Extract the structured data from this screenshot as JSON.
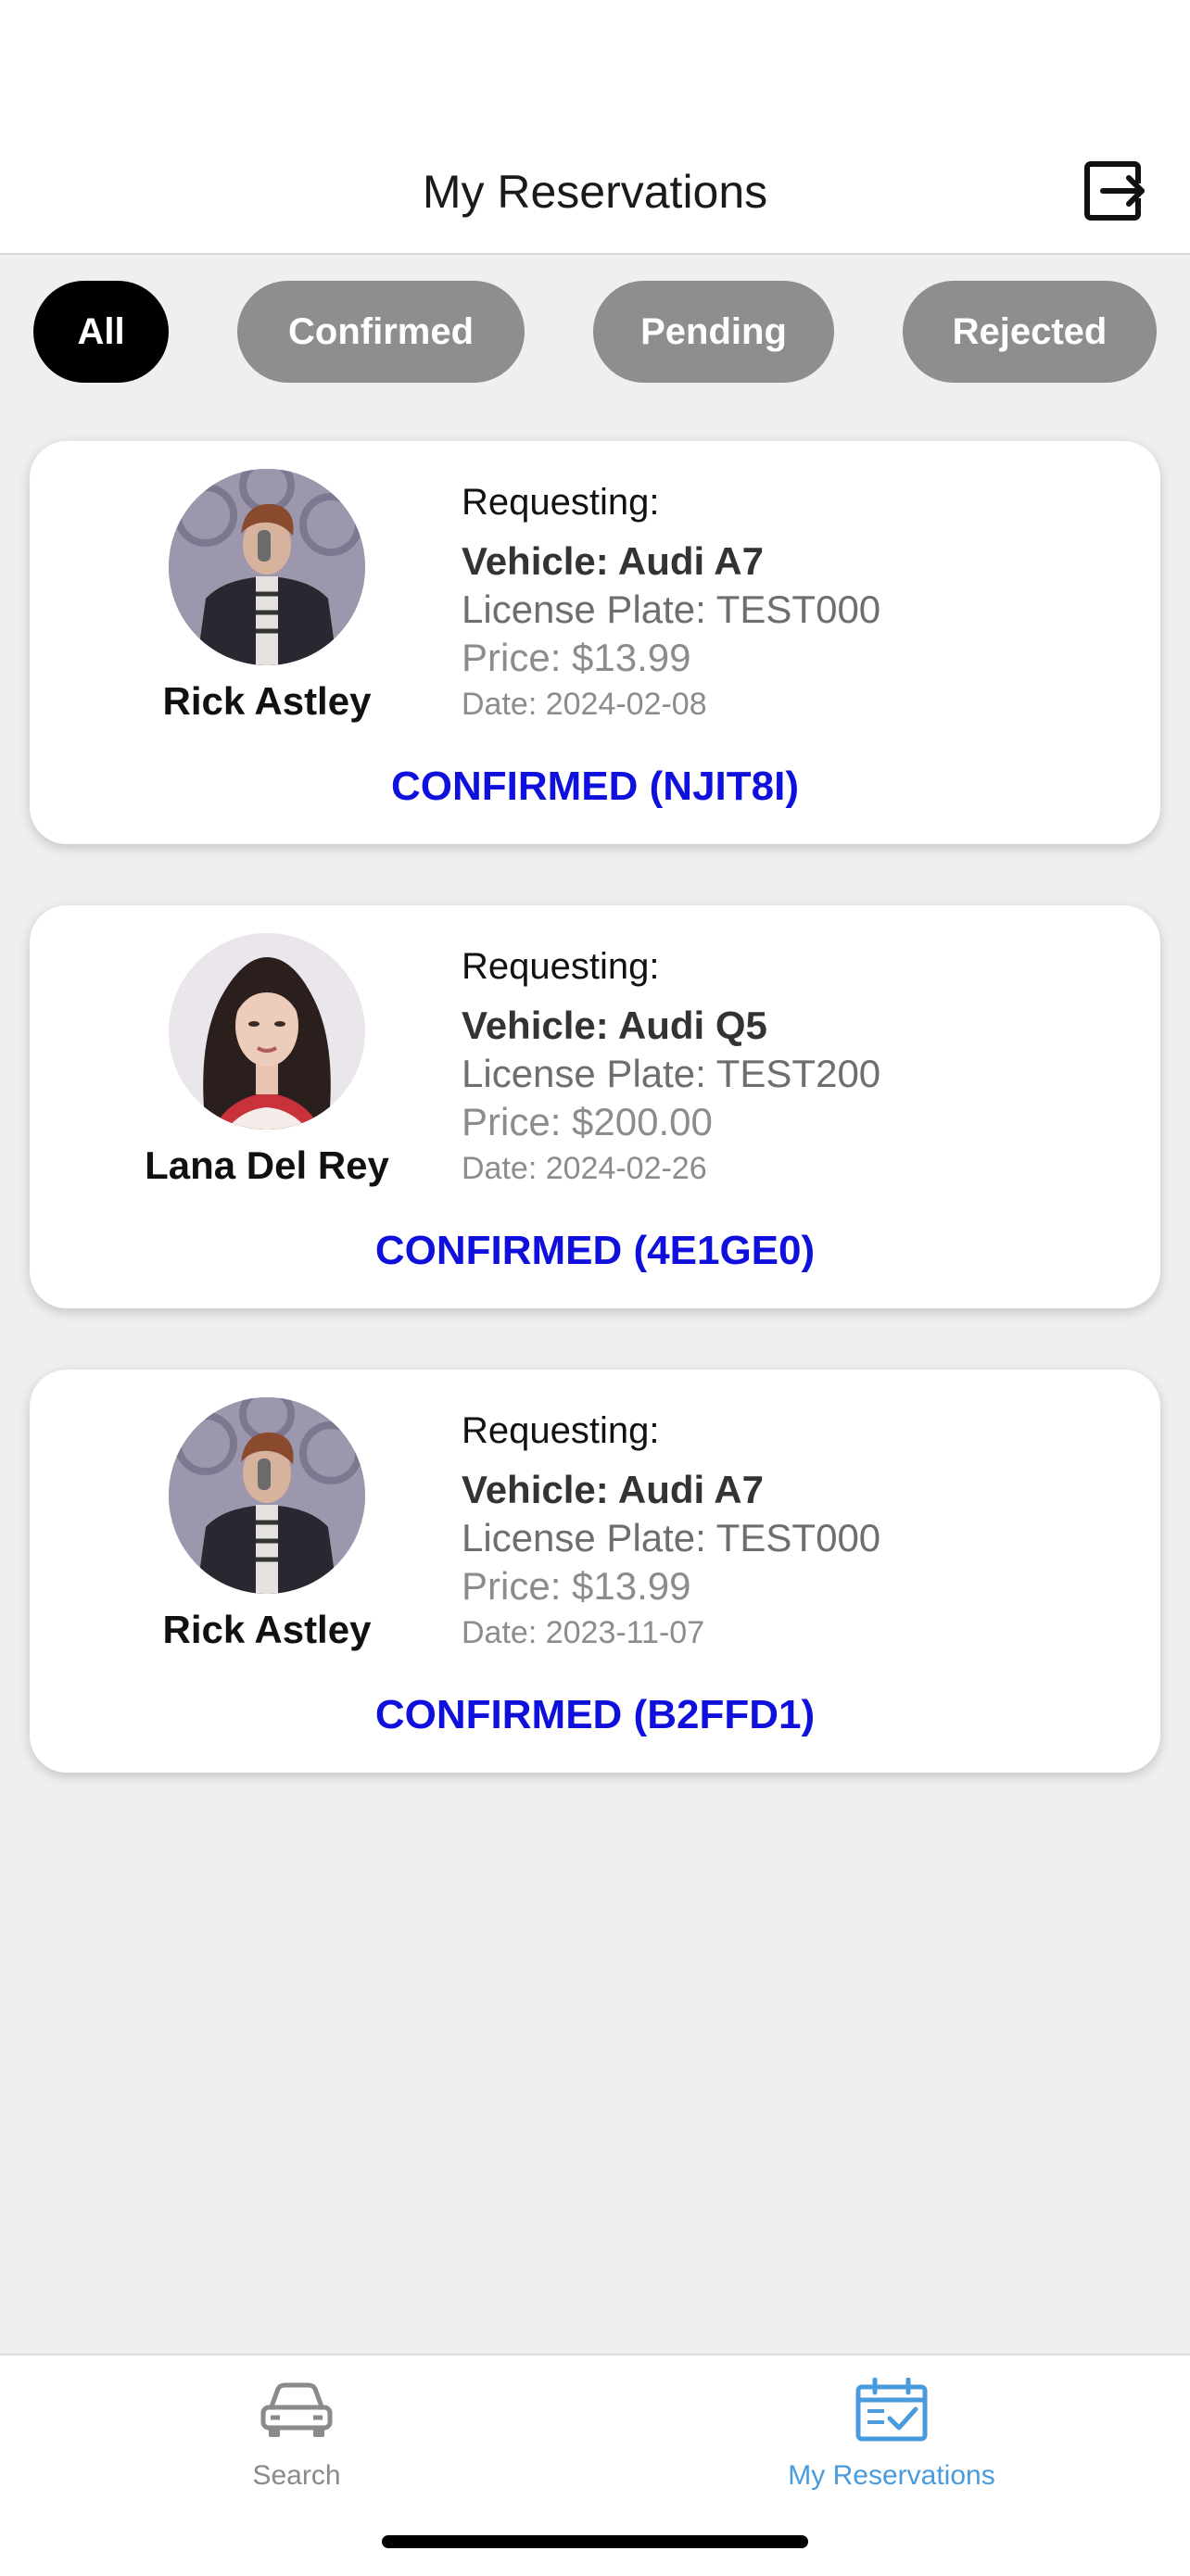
{
  "header": {
    "title": "My Reservations",
    "logout_icon": "logout-icon"
  },
  "filters": [
    {
      "label": "All",
      "active": true
    },
    {
      "label": "Confirmed",
      "active": false
    },
    {
      "label": "Pending",
      "active": false
    },
    {
      "label": "Rejected",
      "active": false
    }
  ],
  "reservations": [
    {
      "name": "Rick Astley",
      "requesting": "Requesting:",
      "vehicle": "Vehicle: Audi A7",
      "plate": "License Plate: TEST000",
      "price": "Price: $13.99",
      "date": "Date: 2024-02-08",
      "status": "CONFIRMED (NJIT8I)"
    },
    {
      "name": "Lana Del Rey",
      "requesting": "Requesting:",
      "vehicle": "Vehicle: Audi Q5",
      "plate": "License Plate: TEST200",
      "price": "Price: $200.00",
      "date": "Date: 2024-02-26",
      "status": "CONFIRMED (4E1GE0)"
    },
    {
      "name": "Rick Astley",
      "requesting": "Requesting:",
      "vehicle": "Vehicle: Audi A7",
      "plate": "License Plate: TEST000",
      "price": "Price: $13.99",
      "date": "Date: 2023-11-07",
      "status": "CONFIRMED (B2FFD1)"
    }
  ],
  "tabbar": {
    "search_label": "Search",
    "reservations_label": "My Reservations",
    "active_color": "#4a9bde",
    "inactive_color": "#8a8a8a"
  },
  "colors": {
    "status_confirmed": "#1010dd",
    "chip_active": "#000000",
    "chip_inactive": "#8e8e8e"
  }
}
